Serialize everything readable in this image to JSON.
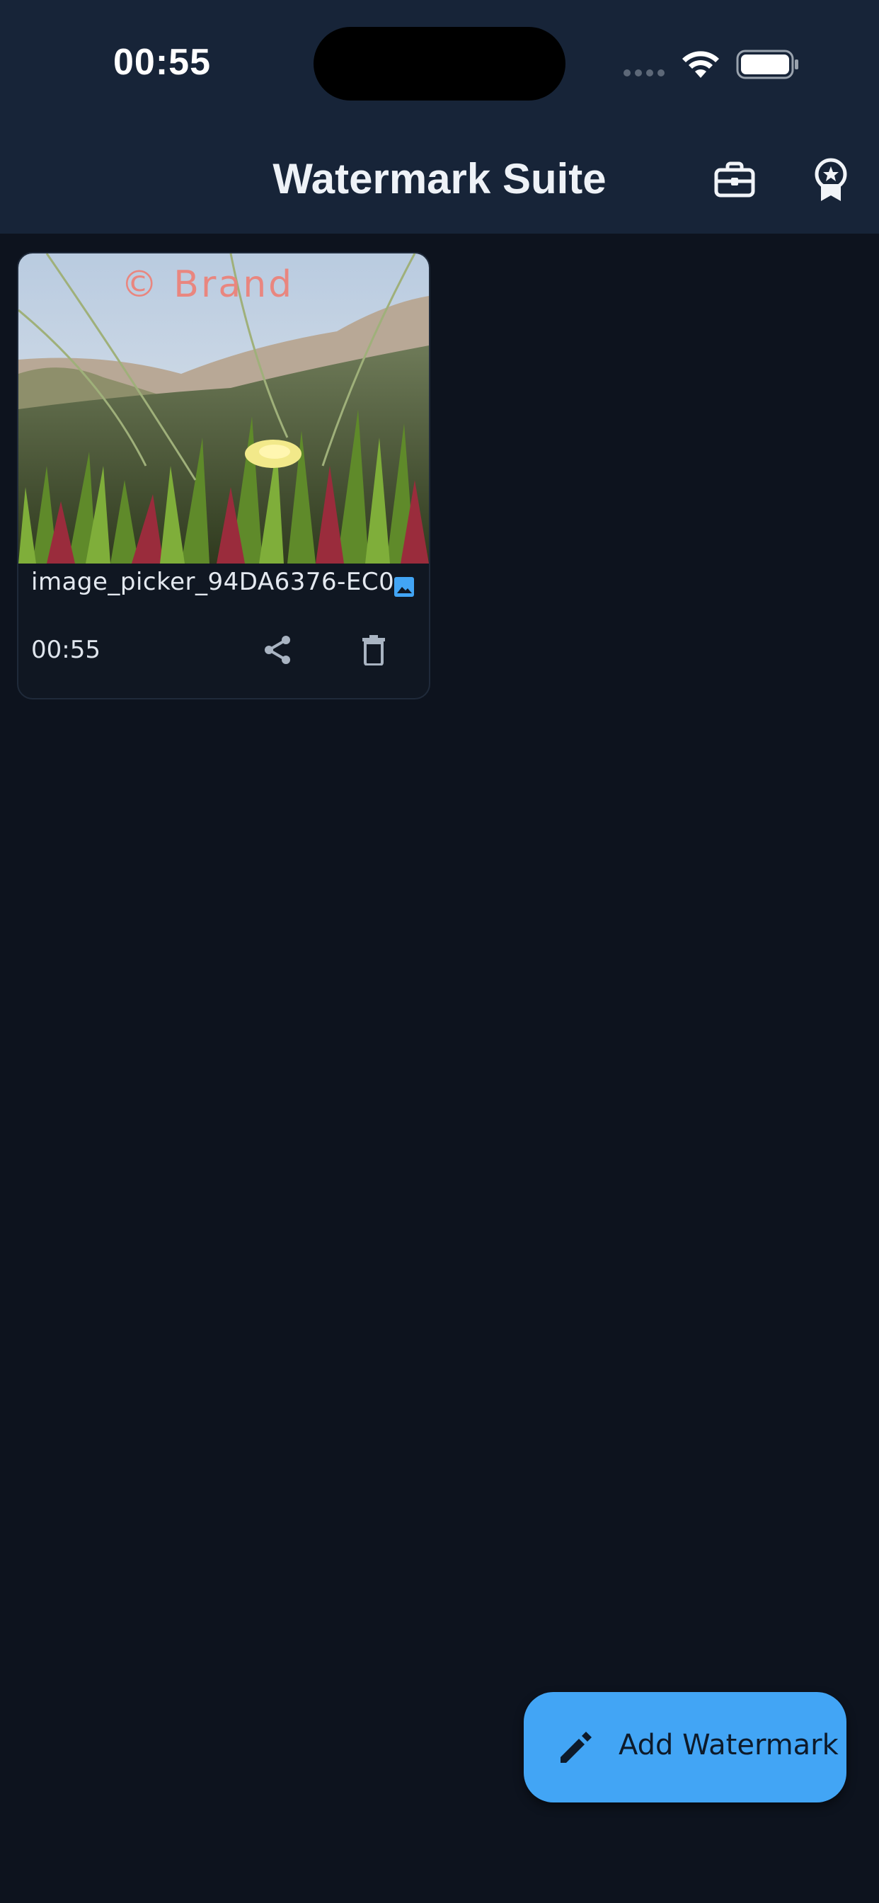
{
  "status_bar": {
    "time": "00:55"
  },
  "app_bar": {
    "title": "Watermark Suite",
    "actions": [
      {
        "name": "tools",
        "icon": "toolbox-icon"
      },
      {
        "name": "premium",
        "icon": "award-badge-icon"
      }
    ]
  },
  "items": [
    {
      "file_name": "image_picker_94DA6376-EC0...",
      "watermark_text": "© Brand",
      "time": "00:55",
      "type_icon": "image-icon",
      "actions": [
        {
          "name": "share",
          "icon": "share-icon"
        },
        {
          "name": "delete",
          "icon": "delete-icon"
        }
      ]
    }
  ],
  "fab": {
    "label": "Add Watermark",
    "icon": "pencil-icon"
  },
  "colors": {
    "app_bar_bg": "#172438",
    "background": "#0d131e",
    "card_bg": "#101722",
    "accent": "#42a5f5",
    "watermark": "#e9867f"
  }
}
